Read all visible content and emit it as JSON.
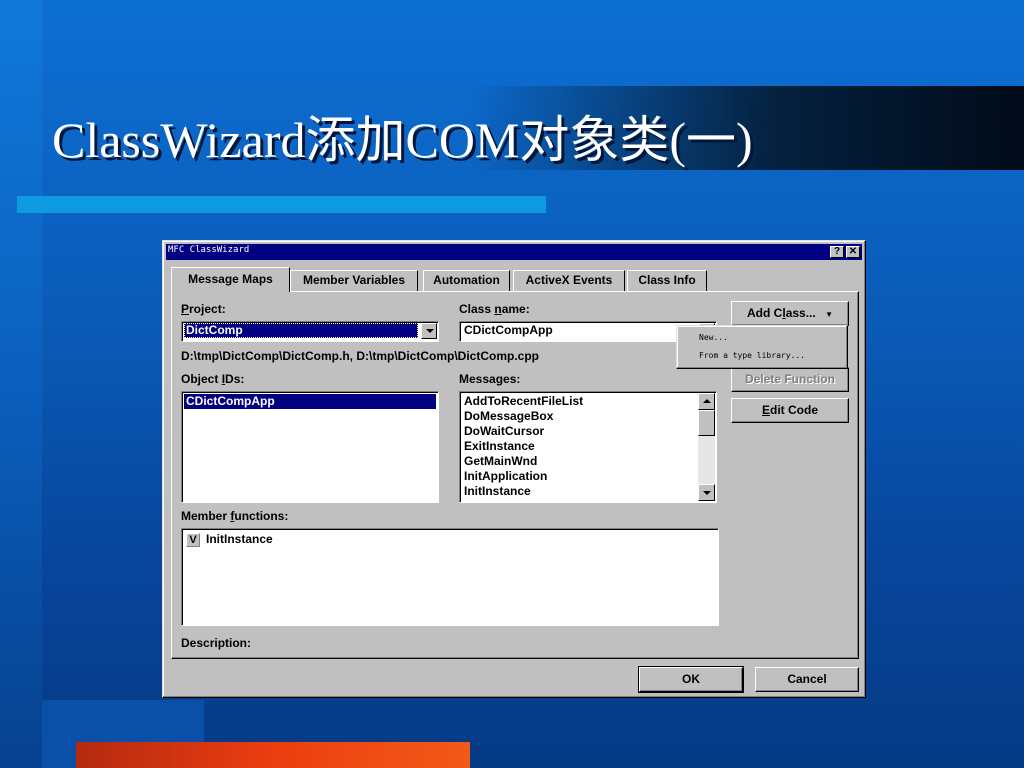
{
  "slide": {
    "title": "ClassWizard添加COM对象类(一)"
  },
  "dialog": {
    "title": "MFC ClassWizard",
    "help_btn": "?",
    "close_btn": "✕",
    "tabs": [
      {
        "label": "Message Maps",
        "active": true
      },
      {
        "label": "Member Variables"
      },
      {
        "label": "Automation"
      },
      {
        "label": "ActiveX Events"
      },
      {
        "label": "Class Info"
      }
    ],
    "project": {
      "label": {
        "pre": "",
        "u": "P",
        "post": "roject:"
      },
      "value": "DictComp"
    },
    "class_name": {
      "label": {
        "pre": "Class ",
        "u": "n",
        "post": "ame:"
      },
      "value": "CDictCompApp"
    },
    "file_path": "D:\\tmp\\DictComp\\DictComp.h, D:\\tmp\\DictComp\\DictComp.cpp",
    "object_ids": {
      "label": {
        "pre": "Object ",
        "u": "I",
        "post": "Ds:"
      },
      "items": [
        "CDictCompApp"
      ]
    },
    "messages": {
      "label": {
        "pre": "",
        "u": "",
        "post": "Messages:"
      },
      "items": [
        "AddToRecentFileList",
        "DoMessageBox",
        "DoWaitCursor",
        "ExitInstance",
        "GetMainWnd",
        "InitApplication",
        "InitInstance"
      ]
    },
    "member_functions": {
      "label": {
        "pre": "Member ",
        "u": "f",
        "post": "unctions:"
      },
      "items": [
        {
          "badge": "V",
          "name": "InitInstance"
        }
      ]
    },
    "description_label": "Description:",
    "buttons": {
      "add_class": {
        "pre": "Add C",
        "u": "l",
        "post": "ass...",
        "arrow": "▼"
      },
      "delete_function": "Delete Function",
      "edit_code": {
        "pre": "",
        "u": "E",
        "post": "dit Code"
      },
      "ok": "OK",
      "cancel": "Cancel"
    },
    "add_class_menu": [
      "New...",
      "From a type library..."
    ]
  }
}
